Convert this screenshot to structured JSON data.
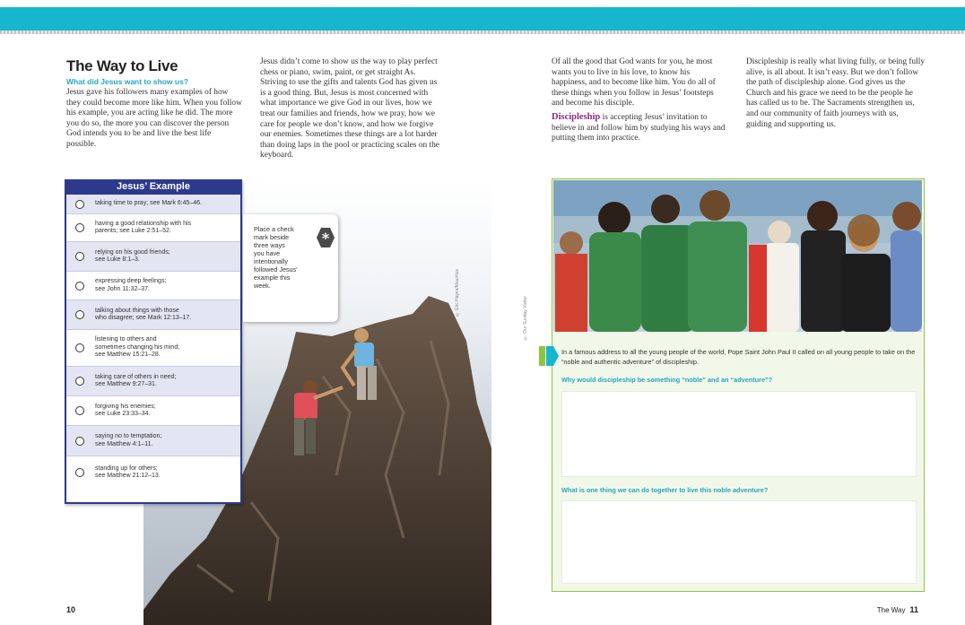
{
  "left_page": {
    "title": "The Way to Live",
    "subtitle": "What did Jesus want to show us?",
    "col1": "Jesus gave his followers many examples of how they could become more like him. When you follow his example, you are acting like he did. The more you do so, the more you can discover the person God intends you to be and live the best life possible.",
    "col2": "Jesus didn’t come to show us the way to play perfect chess or piano, swim, paint, or get straight As. Striving to use the gifts and talents God has given us is a good thing. But, Jesus is most concerned with what importance we give God in our lives, how we treat our families and friends, how we pray, how we care for people we don’t know, and how we forgive our enemies. Sometimes these things are a lot harder than doing laps in the pool or practicing scales on the keyboard.",
    "photo_credit": "© Eric Hayes/Mauritius",
    "page_number": "10"
  },
  "examples": {
    "heading": "Jesus’ Example",
    "items": [
      "taking time to pray; see Mark 6:45–46.",
      "having a good relationship with his\nparents; see Luke 2:51–52.",
      "relying on his good friends;\nsee Luke 8:1–3.",
      "expressing deep feelings;\nsee John 11:32–37.",
      "talking about things with those\nwho disagree; see Mark 12:13–17.",
      "listening to others and\nsometimes changing his mind;\nsee Matthew 15:21–28.",
      "taking care of others in need;\nsee Matthew 9:27–31.",
      "forgiving his enemies;\nsee Luke 23:33–34.",
      "saying no to temptation;\nsee Matthew 4:1–11.",
      "standing up for others;\nsee Matthew 21:12–13."
    ]
  },
  "callout": {
    "text": "Place a check\nmark beside\nthree ways\nyou have\nintentionally\nfollowed Jesus’\nexample this\nweek.",
    "star_glyph": "*"
  },
  "right_page": {
    "col3_p1": "Of all the good that God wants for you, he most wants you to live in his love, to know his happiness, and to become like him. You do all of these things when you follow in Jesus’ footsteps and become his disciple.",
    "col3_term": "Discipleship",
    "col3_def": " is accepting Jesus’ invitation to believe in and follow him by studying his ways and putting them into practice.",
    "col4": "Discipleship is really what living fully, or being fully alive, is all about. It isn’t easy. But we don’t follow the path of discipleship alone. God gives us the Church and his grace we need to be the people he has called us to be. The Sacraments strengthen us, and our community of faith journeys with us, guiding and supporting us.",
    "photo_credit": "© Our Sunday Visitor",
    "intro": "In a famous address to all the young people of the world, Pope Saint John Paul II called on all young people to take on the “noble and authentic adventure” of discipleship.",
    "question1": "Why would discipleship be something “noble” and an “adventure”?",
    "question2": "What is one thing we can do together to live this noble adventure?",
    "answer1": "",
    "answer2": "",
    "folio_label": "The Way",
    "page_number": "11"
  },
  "colors": {
    "top_band": "#16b6cf",
    "subtitle_blue": "#23a6c3",
    "table_navy": "#2d3a8c",
    "term_purple": "#8a2b7f",
    "box_green": "#8cc63f"
  }
}
